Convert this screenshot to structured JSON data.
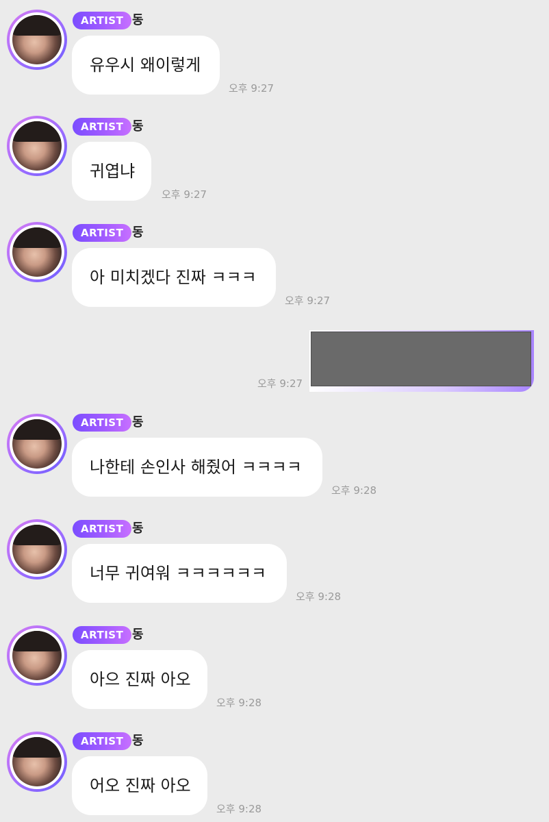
{
  "messages": [
    {
      "badge": "ARTIST",
      "sender": "동",
      "text": "유우시 왜이렇게",
      "time": "오후 9:27"
    },
    {
      "badge": "ARTIST",
      "sender": "동",
      "text": "귀엽냐",
      "time": "오후 9:27"
    },
    {
      "badge": "ARTIST",
      "sender": "동",
      "text": "아 미치겠다 진짜 ㅋㅋㅋ",
      "time": "오후 9:27"
    },
    {
      "badge": "ARTIST",
      "sender": "동",
      "text": "나한테 손인사 해줬어 ㅋㅋㅋㅋ",
      "time": "오후 9:28"
    },
    {
      "badge": "ARTIST",
      "sender": "동",
      "text": "너무 귀여워 ㅋㅋㅋㅋㅋㅋ",
      "time": "오후 9:28"
    },
    {
      "badge": "ARTIST",
      "sender": "동",
      "text": "아으 진짜 아오",
      "time": "오후 9:28"
    },
    {
      "badge": "ARTIST",
      "sender": "동",
      "text": "어오 진짜 아오",
      "time": "오후 9:28"
    }
  ],
  "sent_message": {
    "time": "오후 9:27"
  },
  "colors": {
    "background": "#ebebeb",
    "badge_start": "#7b4dff",
    "badge_end": "#c770ff",
    "bubble": "#ffffff",
    "time": "#9a9a9a"
  }
}
